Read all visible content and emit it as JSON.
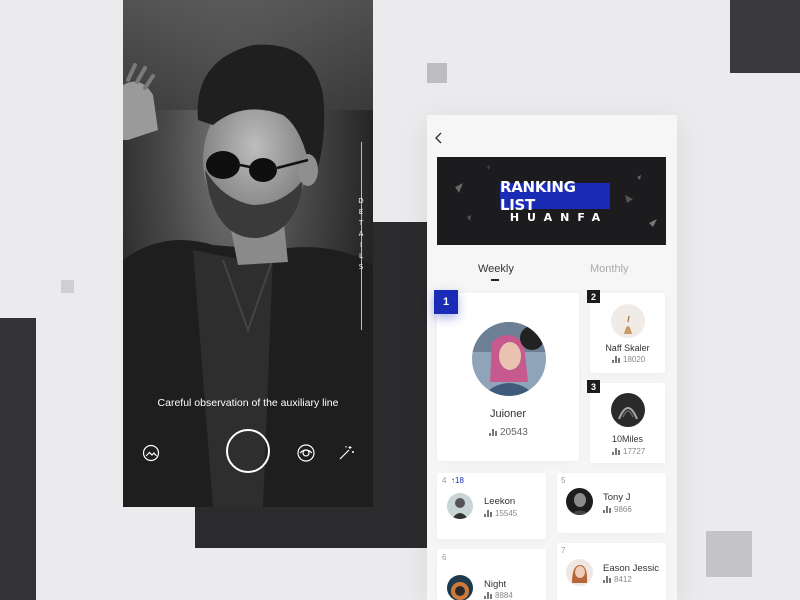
{
  "camera": {
    "details_label": [
      "D",
      "E",
      "T",
      "A",
      "I",
      "L",
      "S"
    ],
    "caption": "Careful observation of the auxiliary line",
    "controls": [
      "gallery-icon",
      "shutter-button",
      "eye-icon",
      "magic-wand-icon"
    ]
  },
  "ranking": {
    "banner_title": "RANKING LIST",
    "banner_sub": "HUANFA",
    "tabs": [
      {
        "label": "Weekly",
        "active": true
      },
      {
        "label": "Monthly",
        "active": false
      }
    ],
    "accent": "#1a2bb5",
    "entries": [
      {
        "rank": "1",
        "name": "Juioner",
        "score": "20543"
      },
      {
        "rank": "2",
        "name": "Naff Skaler",
        "score": "18020"
      },
      {
        "rank": "3",
        "name": "10Miles",
        "score": "17727"
      },
      {
        "rank": "4",
        "name": "Leekon",
        "score": "15545",
        "change": "18"
      },
      {
        "rank": "5",
        "name": "Tony J",
        "score": "9866"
      },
      {
        "rank": "6",
        "name": "Night",
        "score": "8884"
      },
      {
        "rank": "7",
        "name": "Eason Jessic",
        "score": "8412"
      }
    ]
  }
}
